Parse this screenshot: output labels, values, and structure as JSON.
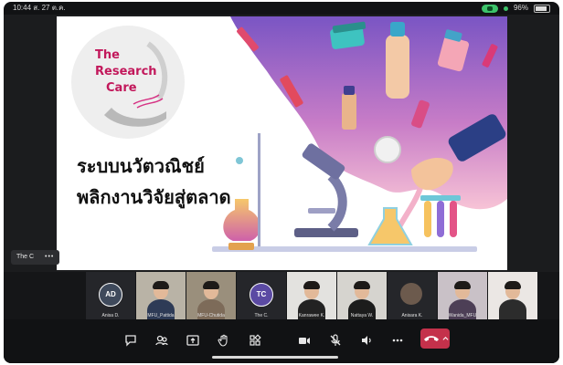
{
  "status_bar": {
    "time": "10:44  ส. 27 ต.ค.",
    "battery": "96%"
  },
  "slide": {
    "logo_lines": [
      "The",
      "Research",
      "Care"
    ],
    "headline_line1": "ระบบนวัตวณิชย์",
    "headline_line2": "พลิกงานวิจัยสู่ตลาด"
  },
  "presenter_tag": {
    "name": "The C",
    "more": "•••"
  },
  "participants": [
    {
      "type": "initials",
      "initials": "AD",
      "label": "Anisa D.",
      "color": "#3f4a5c"
    },
    {
      "type": "video",
      "label": "MFU_Pattida",
      "bg": "#b9b3a6",
      "shirt": "#2e3b56"
    },
    {
      "type": "video",
      "label": "MFU-Chutida",
      "bg": "#9a8f7c",
      "shirt": "#7d6b59"
    },
    {
      "type": "initials",
      "initials": "TC",
      "label": "The C.",
      "color": "#5b4aa3"
    },
    {
      "type": "video",
      "label": "Kanrawee K.",
      "bg": "#e3e2df",
      "shirt": "#222222"
    },
    {
      "type": "video",
      "label": "Nattaya W.",
      "bg": "#d6d4cf",
      "shirt": "#1c1c1c"
    },
    {
      "type": "photo",
      "label": "Anisara K.",
      "color": "#6c5a4d"
    },
    {
      "type": "video",
      "label": "Wanida_MFU",
      "bg": "#c9c1c7",
      "shirt": "#4d3f56"
    },
    {
      "type": "video",
      "label": "",
      "bg": "#ebe7e4",
      "shirt": "#2c2c2c"
    }
  ],
  "controls": [
    {
      "name": "chat-icon"
    },
    {
      "name": "participants-icon"
    },
    {
      "name": "share-icon"
    },
    {
      "name": "reactions-icon"
    },
    {
      "name": "apps-icon"
    },
    {
      "name": "camera-icon"
    },
    {
      "name": "mic-off-icon"
    },
    {
      "name": "speaker-icon"
    },
    {
      "name": "more-icon"
    }
  ],
  "colors": {
    "leave_button": "#c4314b",
    "status_green": "#3cc36a",
    "slide_gradient_top": "#8a63c9",
    "slide_gradient_bottom": "#f5b8cf"
  }
}
